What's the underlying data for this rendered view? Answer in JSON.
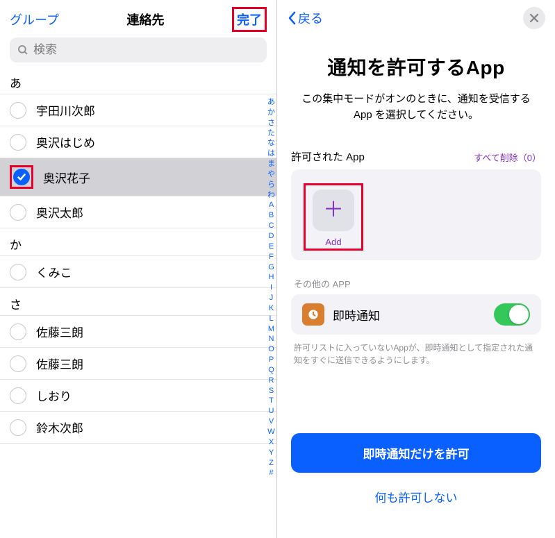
{
  "left": {
    "group_btn": "グループ",
    "title": "連絡先",
    "done_btn": "完了",
    "search_placeholder": "検索",
    "sections": [
      {
        "header": "あ",
        "contacts": [
          {
            "name": "宇田川次郎",
            "checked": false,
            "highlighted": false
          },
          {
            "name": "奥沢はじめ",
            "checked": false,
            "highlighted": false
          },
          {
            "name": "奥沢花子",
            "checked": true,
            "highlighted": true
          },
          {
            "name": "奥沢太郎",
            "checked": false,
            "highlighted": false
          }
        ]
      },
      {
        "header": "か",
        "contacts": [
          {
            "name": "くみこ",
            "checked": false,
            "highlighted": false
          }
        ]
      },
      {
        "header": "さ",
        "contacts": [
          {
            "name": "佐藤三朗",
            "checked": false,
            "highlighted": false
          },
          {
            "name": "佐藤三朗",
            "checked": false,
            "highlighted": false
          },
          {
            "name": "しおり",
            "checked": false,
            "highlighted": false
          },
          {
            "name": "鈴木次郎",
            "checked": false,
            "highlighted": false
          }
        ]
      }
    ],
    "index": [
      "あ",
      "か",
      "さ",
      "た",
      "な",
      "は",
      "ま",
      "や",
      "ら",
      "わ",
      "A",
      "B",
      "C",
      "D",
      "E",
      "F",
      "G",
      "H",
      "I",
      "J",
      "K",
      "L",
      "M",
      "N",
      "O",
      "P",
      "Q",
      "R",
      "S",
      "T",
      "U",
      "V",
      "W",
      "X",
      "Y",
      "Z",
      "#"
    ]
  },
  "right": {
    "back": "戻る",
    "title": "通知を許可するApp",
    "subtitle": "この集中モードがオンのときに、通知を受信する App を選択してください。",
    "allowed_label": "許可された App",
    "clear_all": "すべて削除（0）",
    "add_label": "Add",
    "other_label": "その他の APP",
    "app_name": "即時通知",
    "footnote": "許可リストに入っていないAppが、即時通知として指定された通知をすぐに送信できるようにします。",
    "primary_btn": "即時通知だけを許可",
    "secondary_btn": "何も許可しない"
  }
}
